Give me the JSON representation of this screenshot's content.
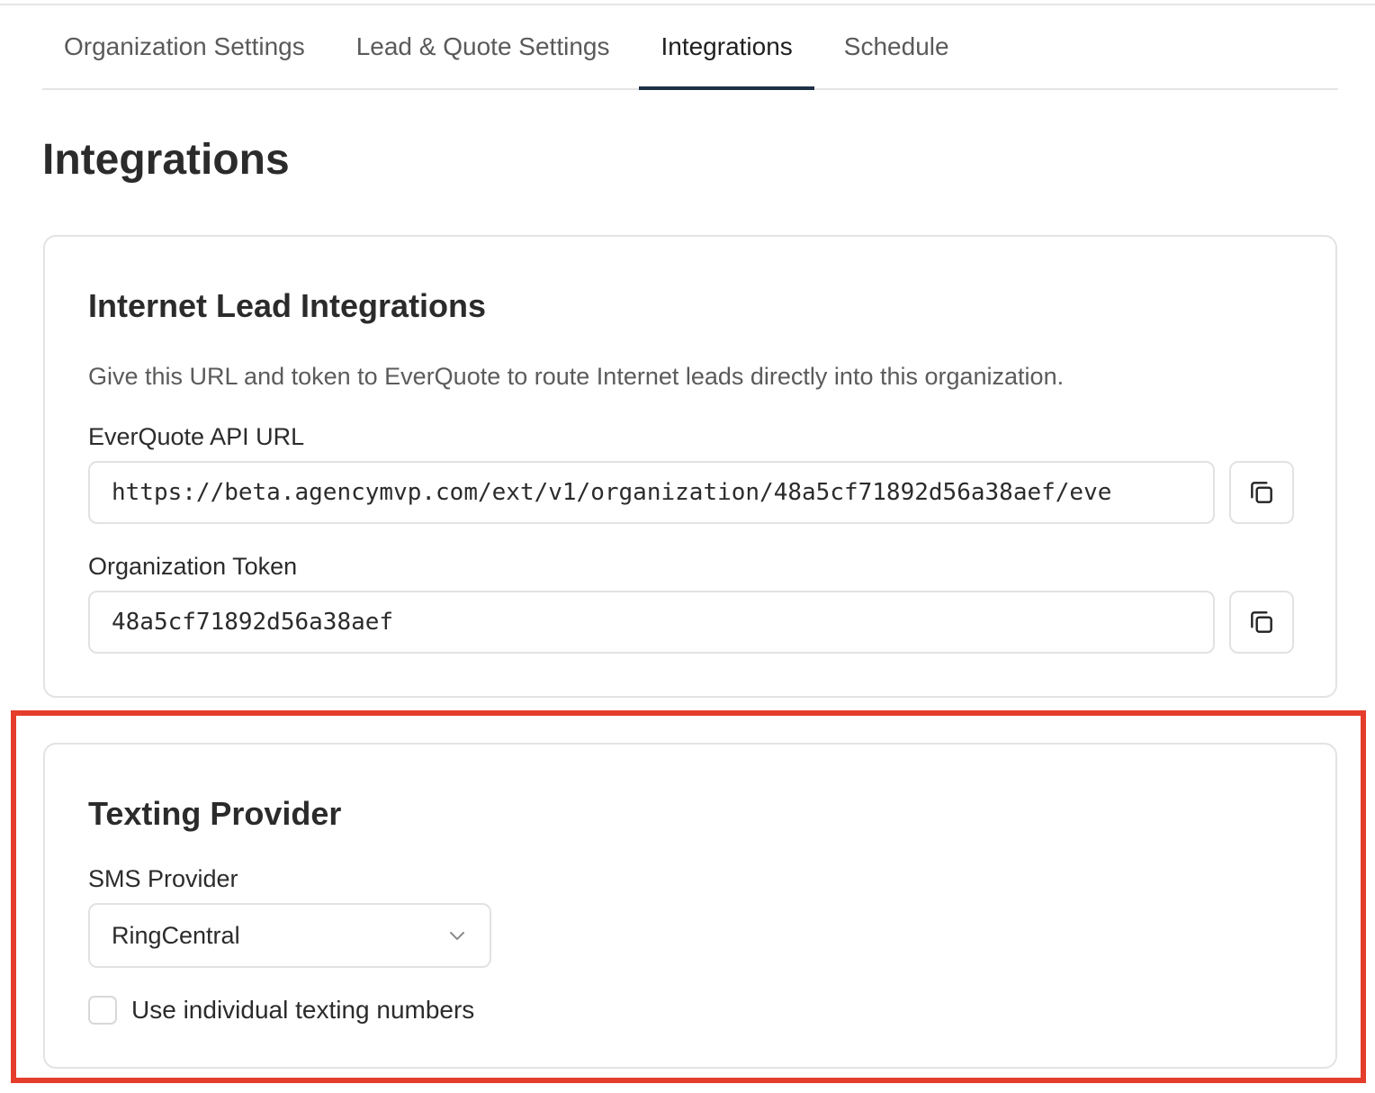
{
  "tabs": [
    {
      "label": "Organization Settings",
      "active": false
    },
    {
      "label": "Lead & Quote Settings",
      "active": false
    },
    {
      "label": "Integrations",
      "active": true
    },
    {
      "label": "Schedule",
      "active": false
    }
  ],
  "page": {
    "title": "Integrations"
  },
  "internet_lead": {
    "title": "Internet Lead Integrations",
    "description": "Give this URL and token to EverQuote to route Internet leads directly into this organization.",
    "api_url_label": "EverQuote API URL",
    "api_url_value": "https://beta.agencymvp.com/ext/v1/organization/48a5cf71892d56a38aef/eve",
    "token_label": "Organization Token",
    "token_value": "48a5cf71892d56a38aef"
  },
  "texting": {
    "title": "Texting Provider",
    "sms_label": "SMS Provider",
    "sms_selected": "RingCentral",
    "individual_numbers_label": "Use individual texting numbers",
    "individual_numbers_checked": false
  },
  "icons": {
    "copy": "copy-icon",
    "chevron": "chevron-down-icon"
  },
  "colors": {
    "active_tab_underline": "#1d3046",
    "highlight_border": "#e53d2b"
  }
}
